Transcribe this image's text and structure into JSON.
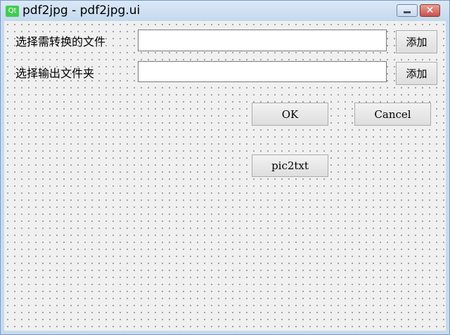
{
  "window": {
    "title": "pdf2jpg - pdf2jpg.ui",
    "icon_text": "Qt",
    "close_glyph": "✕"
  },
  "form": {
    "source_label": "选择需转换的文件",
    "source_value": "",
    "source_add_label": "添加",
    "output_label": "选择输出文件夹",
    "output_value": "",
    "output_add_label": "添加",
    "ok_label": "OK",
    "cancel_label": "Cancel",
    "pic2txt_label": "pic2txt"
  }
}
